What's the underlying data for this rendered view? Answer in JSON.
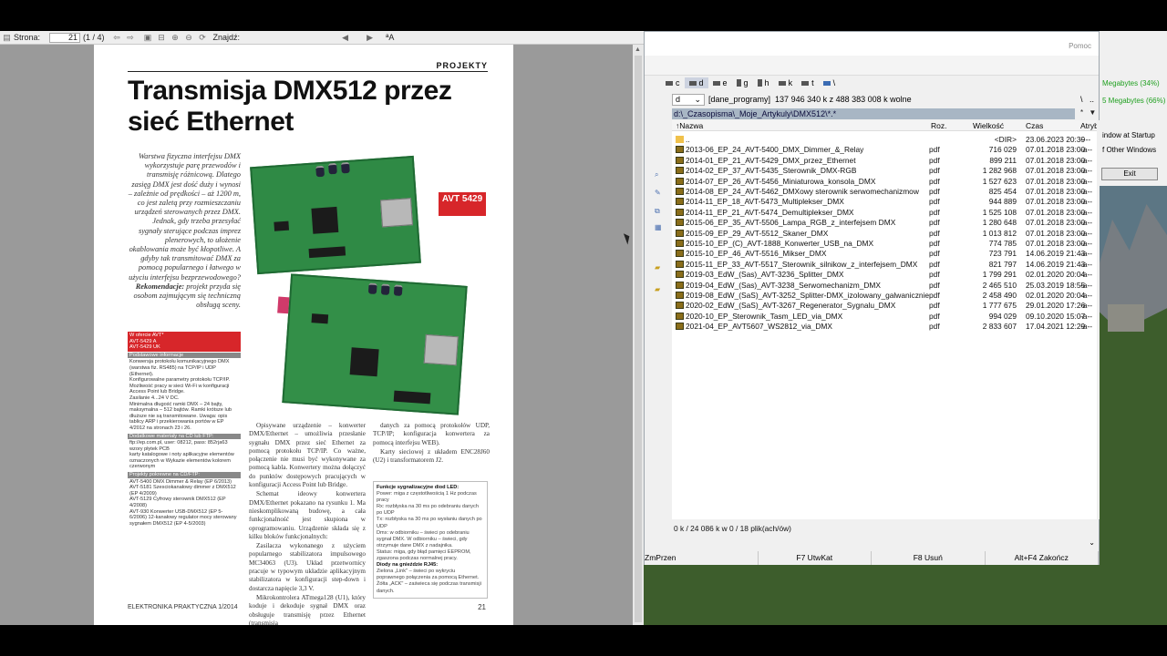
{
  "pdf_viewer": {
    "page_label": "Strona:",
    "page_current": "21",
    "page_total": "(1 / 4)",
    "find_label": "Znajdź:",
    "fit_label": "A"
  },
  "pdf_page": {
    "section": "PROJEKTY",
    "title": "Transmisja DMX512 przez sieć Ethernet",
    "lead": "Warstwa fizyczna interfejsu DMX wykorzystuje parę przewodów i transmisję różnicową. Dlatego zasięg DMX jest dość duży i wynosi – zależnie od prędkości – aż 1200 m, co jest zaletą przy rozmieszczaniu urządzeń sterowanych przez DMX. Jednak, gdy trzeba przesyłać sygnały sterujące podczas imprez plenerowych, to ułożenie okablowania może być kłopotliwe. A gdyby tak transmitować DMX za pomocą popularnego i łatwego w użyciu interfejsu bezprzewodowego?",
    "lead_rec_label": "Rekomendacje:",
    "lead_rec": "projekt przyda się osobom zajmującym się techniczną obsługą sceny.",
    "badge": "AVT 5429",
    "spec_head": [
      "W ofercie AVT*",
      "AVT-5429 A",
      "AVT-5429 UK"
    ],
    "spec_sub1": "Podstawowe informacje",
    "spec_items": [
      "Konwersja protokołu komunikacyjnego DMX (warstwa fiz. RS485) na TCP/IP i UDP (Ethernet).",
      "Konfigurowalne parametry protokołu TCP/IP.",
      "Możliwość pracy w sieci Wi-Fi w konfiguracji Access Point lub Bridge.",
      "Zasilanie 4...24 V DC.",
      "Minimalna długość ramki DMX – 24 bajty, maksymalna – 512 bajtów. Ramki krótsze lub dłuższe nie są transmitowane. Uwaga: opis tablicy ARP i przekierowania portów w EP 4/2012 na stronach 23 i 26."
    ],
    "spec_sub2": "Dodatkowe materiały na CD lub FTP:",
    "spec_ftp": "ftp://ep.com.pl, user: 08212, pass: 852rja63",
    "spec_items2": [
      "wzory płytek PCB",
      "karty katalogowe i noty aplikacyjne elementów oznaczonych w Wykazie elementów kolorem czerwonym"
    ],
    "spec_sub3": "Projekty pokrewne na CD/FTP:",
    "spec_related": [
      "AVT-5400  DMX Dimmer & Relay (EP 6/2013)",
      "AVT-5181  Szesciokanałowy dimmer z DMX512 (EP 4/2009)",
      "AVT-5129  Cyfrowy sterownik DMX512 (EP 4/2008)",
      "AVT-930  Konwerter USB-DMX512 (EP 5-6/2006) 12-kanałowy regulator mocy sterowany sygnałem DMX512 (EP 4-5/2003)"
    ],
    "col2": [
      "Opisywane urządzenie – konwerter DMX/Ethernet – umożliwia przesłanie sygnału DMX przez sieć Ethernet za pomocą protokołu TCP/IP. Co ważne, połączenie nie musi być wykonywane za pomocą kabla. Konwertery można dołączyć do punktów dostępowych pracujących w konfiguracji Access Point lub Bridge.",
      "Schemat ideowy konwertera DMX/Ethernet pokazano na rysunku 1. Ma nieskomplikowaną budowę, a cała funkcjonalność jest skupiona w oprogramowaniu. Urządzenie składa się z kilku bloków funkcjonalnych:",
      "Zasilacza wykonanego z użyciem popularnego stabilizatora impulsowego MC34063 (U3). Układ przetwornicy pracuje w typowym układzie aplikacyjnym stabilizatora w konfiguracji step-down i dostarcza napięcie 3,3 V.",
      "Mikrokontrolera ATmega128 (U1), który koduje i dekoduje sygnał DMX oraz obsługuje transmisję przez Ethernet (transmisja"
    ],
    "col3": [
      "danych za pomocą protokołów UDP, TCP/IP; konfiguracja konwertera za pomocą interfejsu WEB).",
      "Karty sieciowej z układem ENC28J60 (U2) i transformatorem J2."
    ],
    "callout_head": "Funkcje sygnalizacyjne diod LED:",
    "callout_items": [
      "Power: miga z częstotliwością 1 Hz podczas pracy",
      "Rx: rozbłyska na 30 ms po odebraniu danych po UDP",
      "Tx: rozbłyska na 30 ms po wysłaniu danych po UDP",
      "Dmx: w odbiorniku – świeci po odebraniu sygnał DMX. W odbiorniku – świeci, gdy otrzymuje dane DMX z nadajnika.",
      "Status: miga, gdy błąd pamięci EEPROM, zgaszona podczas normalnej pracy."
    ],
    "callout_head2": "Diody na gnieździe RJ45:",
    "callout_items2": [
      "Zielona „Link\" – świeci po wykryciu poprawnego połączenia za pomocą Ethernet.",
      "Żółta „ACK\" – zaświeca się podczas transmisji danych."
    ],
    "footer_left": "ELEKTRONIKA PRAKTYCZNA 1/2014",
    "footer_right": "21"
  },
  "back_window": {
    "mb1": "Megabytes (34%)",
    "mb2": "5 Megabytes (66%)",
    "opt1": "indow at Startup",
    "opt2": "f Other Windows",
    "exit": "Exit"
  },
  "total_commander": {
    "help": "Pomoc",
    "drives": [
      "c",
      "d",
      "e",
      "g",
      "h",
      "k",
      "t",
      "\\"
    ],
    "active_drive": "d",
    "drive_combo": "d",
    "volume_label": "[dane_programy]",
    "free_space": "137 946 340 k z 488 383 008 k wolne",
    "nav_back": "\\",
    "nav_up": "..",
    "path": "d:\\_Czasopisma\\_Moje_Artykuly\\DMX512\\*.*",
    "path_star": "*",
    "path_arrow": "▼",
    "columns": {
      "name": "↑Nazwa",
      "ext": "Roz.",
      "size": "Wielkość",
      "date": "Czas",
      "attr": "Atryb"
    },
    "files": [
      {
        "name": "..",
        "ext": "",
        "size": "<DIR>",
        "date": "23.06.2023 20:39",
        "attr": "----",
        "up": true
      },
      {
        "name": "2013-06_EP_24_AVT-5400_DMX_Dimmer_&_Relay",
        "ext": "pdf",
        "size": "716 029",
        "date": "07.01.2018 23:00",
        "attr": "-a--"
      },
      {
        "name": "2014-01_EP_21_AVT-5429_DMX_przez_Ethernet",
        "ext": "pdf",
        "size": "899 211",
        "date": "07.01.2018 23:00",
        "attr": "-a--"
      },
      {
        "name": "2014-02_EP_37_AVT-5435_Sterownik_DMX-RGB",
        "ext": "pdf",
        "size": "1 282 968",
        "date": "07.01.2018 23:00",
        "attr": "-a--"
      },
      {
        "name": "2014-07_EP_26_AVT-5456_Miniaturowa_konsola_DMX",
        "ext": "pdf",
        "size": "1 527 623",
        "date": "07.01.2018 23:00",
        "attr": "-a--"
      },
      {
        "name": "2014-08_EP_24_AVT-5462_DMXowy sterownik serwomechanizmow",
        "ext": "pdf",
        "size": "825 454",
        "date": "07.01.2018 23:00",
        "attr": "-a--"
      },
      {
        "name": "2014-11_EP_18_AVT-5473_Multiplekser_DMX",
        "ext": "pdf",
        "size": "944 889",
        "date": "07.01.2018 23:00",
        "attr": "-a--"
      },
      {
        "name": "2014-11_EP_21_AVT-5474_Demultiplekser_DMX",
        "ext": "pdf",
        "size": "1 525 108",
        "date": "07.01.2018 23:00",
        "attr": "-a--"
      },
      {
        "name": "2015-06_EP_35_AVT-5506_Lampa_RGB_z_interfejsem DMX",
        "ext": "pdf",
        "size": "1 280 648",
        "date": "07.01.2018 23:00",
        "attr": "-a--"
      },
      {
        "name": "2015-09_EP_29_AVT-5512_Skaner_DMX",
        "ext": "pdf",
        "size": "1 013 812",
        "date": "07.01.2018 23:00",
        "attr": "-a--"
      },
      {
        "name": "2015-10_EP_(C)_AVT-1888_Konwerter_USB_na_DMX",
        "ext": "pdf",
        "size": "774 785",
        "date": "07.01.2018 23:00",
        "attr": "-a--"
      },
      {
        "name": "2015-10_EP_46_AVT-5516_Mikser_DMX",
        "ext": "pdf",
        "size": "723 791",
        "date": "14.06.2019 21:43",
        "attr": "-a--"
      },
      {
        "name": "2015-11_EP_33_AVT-5517_Sterownik_silnikow_z_interfejsem_DMX",
        "ext": "pdf",
        "size": "821 797",
        "date": "14.06.2019 21:43",
        "attr": "-a--"
      },
      {
        "name": "2019-03_EdW_(Sas)_AVT-3236_Splitter_DMX",
        "ext": "pdf",
        "size": "1 799 291",
        "date": "02.01.2020 20:04",
        "attr": "-a--"
      },
      {
        "name": "2019-04_EdW_(Sas)_AVT-3238_Serwomechanizm_DMX",
        "ext": "pdf",
        "size": "2 465 510",
        "date": "25.03.2019 18:55",
        "attr": "-a--"
      },
      {
        "name": "2019-08_EdW_(SaS)_AVT-3252_Splitter-DMX_izolowany_galwanicznie",
        "ext": "pdf",
        "size": "2 458 490",
        "date": "02.01.2020 20:04",
        "attr": "-a--"
      },
      {
        "name": "2020-02_EdW_(SaS)_AVT-3267_Regenerator_Sygnalu_DMX",
        "ext": "pdf",
        "size": "1 777 675",
        "date": "29.01.2020 17:26",
        "attr": "-a--"
      },
      {
        "name": "2020-10_EP_Sterownik_Tasm_LED_via_DMX",
        "ext": "pdf",
        "size": "994 029",
        "date": "09.10.2020 15:07",
        "attr": "-a--"
      },
      {
        "name": "2021-04_EP_AVT5607_WS2812_via_DMX",
        "ext": "pdf",
        "size": "2 833 607",
        "date": "17.04.2021 12:29",
        "attr": "-a--"
      }
    ],
    "status": "0 k / 24 086 k w 0 / 18 plik(ach/ów)",
    "fkeys": [
      "ZmPrzen",
      "F7 UtwKat",
      "F8 Usuń",
      "Alt+F4 Zakończ"
    ]
  }
}
